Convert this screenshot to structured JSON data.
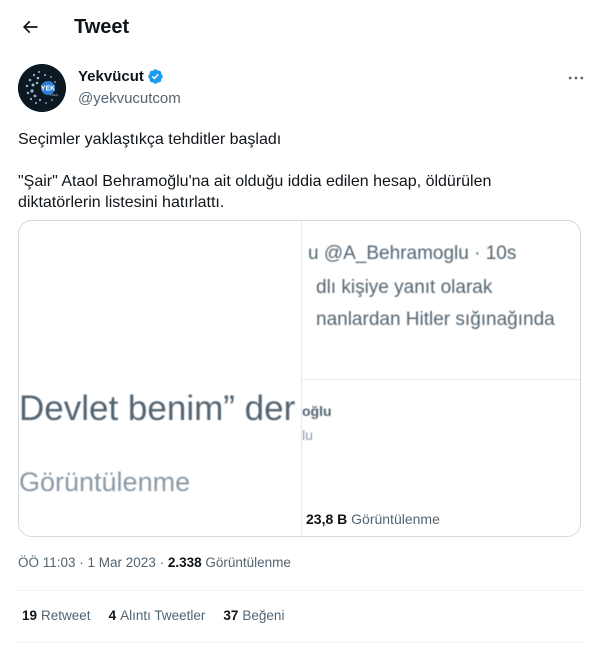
{
  "header": {
    "title": "Tweet"
  },
  "author": {
    "display_name": "Yekvücut",
    "handle": "@yekvucutcom",
    "avatar_text": "YEK",
    "avatar_subtext": "vücut"
  },
  "tweet": {
    "line1": "Seçimler yaklaştıkça tehditler başladı",
    "line2": "\"Şair\" Ataol Behramoğlu'na ait olduğu iddia edilen hesap, öldürülen",
    "line3": "diktatörlerin listesini hatırlattı."
  },
  "media": {
    "left_big_text": "Devlet benim” der",
    "left_views_text": "Görüntülenme",
    "right_line1": "u @A_Behramoglu · 10s",
    "right_line2": "dlı kişiye yanıt olarak",
    "right_line3": "nanlardan Hitler sığınağında",
    "right_name": "oğlu",
    "right_sub": "lu",
    "right_views_count": "23,8 B",
    "right_views_label": "Görüntülenme"
  },
  "meta": {
    "time_date": "ÖÖ 11:03 · 1 Mar 2023 · ",
    "views_count": "2.338",
    "views_label": "Görüntülenme"
  },
  "stats": {
    "retweet_count": "19",
    "retweet_label": "Retweet",
    "quote_count": "4",
    "quote_label": "Alıntı Tweetler",
    "like_count": "37",
    "like_label": "Beğeni"
  },
  "colors": {
    "text_primary": "#0f1419",
    "text_secondary": "#536471",
    "verified_blue": "#1d9bf0",
    "border": "#cfd9de"
  },
  "icons": {
    "back": "arrow-left-icon",
    "verified": "verified-badge-icon",
    "more": "more-horizontal-icon"
  }
}
